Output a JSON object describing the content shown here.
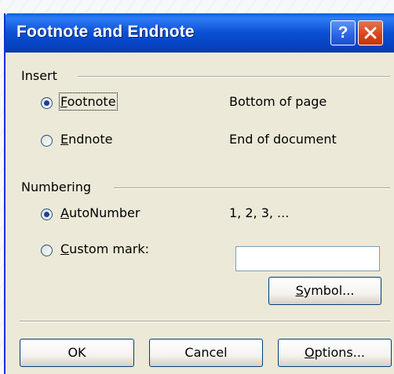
{
  "dialog": {
    "title": "Footnote and Endnote",
    "help_label": "?",
    "close_icon": "close-icon"
  },
  "insert": {
    "heading": "Insert",
    "options": [
      {
        "label_pre": "",
        "label_u": "F",
        "label_post": "ootnote",
        "location": "Bottom of page",
        "selected": true
      },
      {
        "label_pre": "",
        "label_u": "E",
        "label_post": "ndnote",
        "location": "End of document",
        "selected": false
      }
    ]
  },
  "numbering": {
    "heading": "Numbering",
    "autonumber": {
      "label_pre": "",
      "label_u": "A",
      "label_post": "utoNumber",
      "value": "1, 2, 3, ...",
      "selected": true
    },
    "custom": {
      "label_pre": "",
      "label_u": "C",
      "label_post": "ustom mark:",
      "value": "",
      "selected": false
    },
    "symbol_button": {
      "label_pre": "",
      "label_u": "S",
      "label_post": "ymbol..."
    }
  },
  "buttons": {
    "ok": "OK",
    "cancel": "Cancel",
    "options_u": "O",
    "options_post": "ptions..."
  }
}
